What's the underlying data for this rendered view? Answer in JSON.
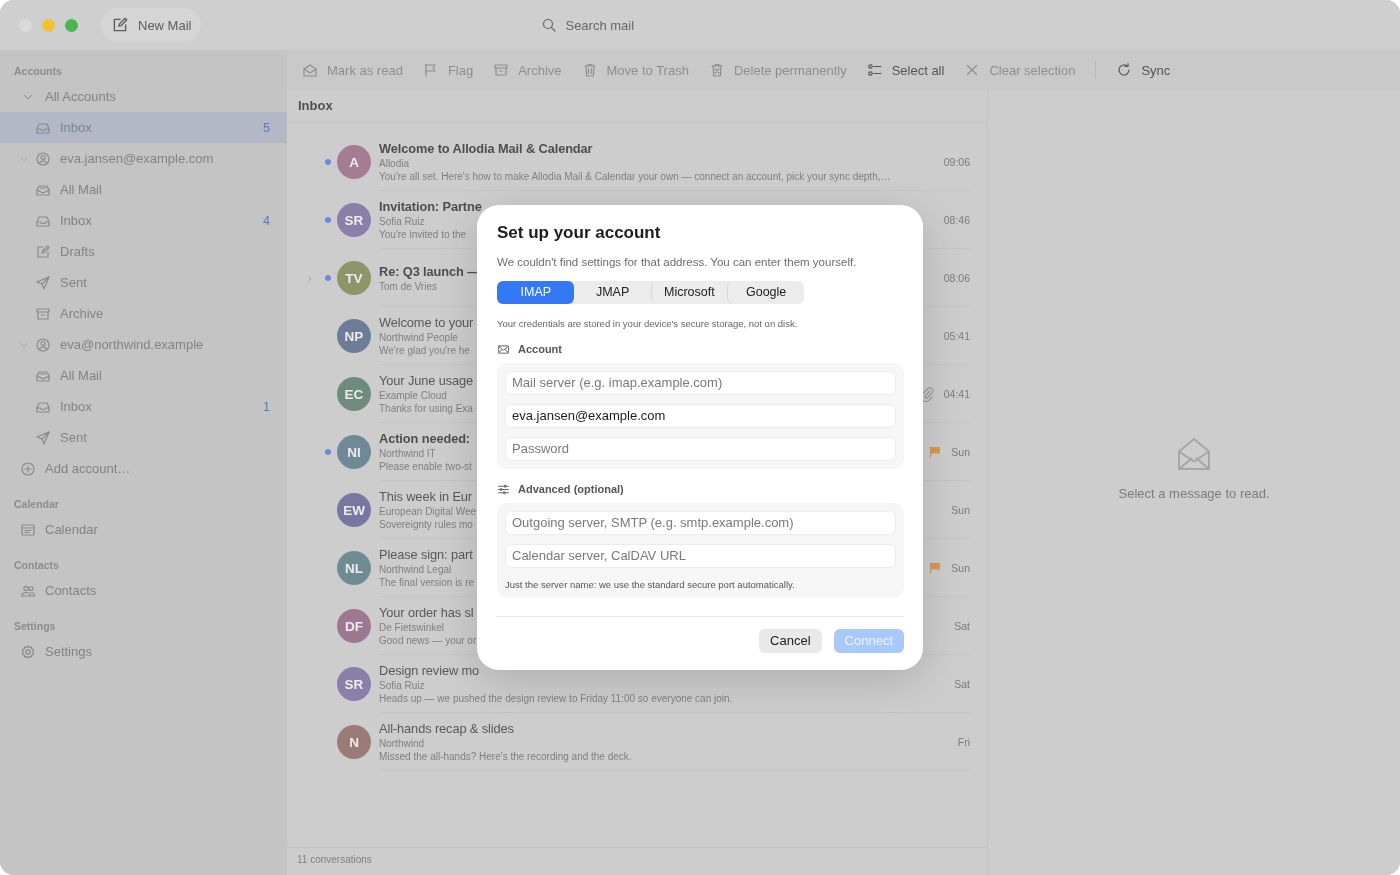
{
  "titlebar": {
    "new_mail": "New Mail",
    "search": {
      "placeholder": "Search mail"
    }
  },
  "sidebar": {
    "sections": [
      {
        "title": "Accounts",
        "items": [
          {
            "label": "All Accounts",
            "kind": "group",
            "selected": false,
            "expanded": true,
            "children": [
              {
                "label": "Inbox",
                "kind": "inbox",
                "selected": true,
                "count": "5"
              }
            ]
          },
          {
            "label": "eva.jansen@example.com",
            "kind": "account",
            "selected": false,
            "expanded": true,
            "children": [
              {
                "label": "All Mail",
                "kind": "all-mail",
                "selected": false
              },
              {
                "label": "Inbox",
                "kind": "inbox",
                "selected": false,
                "count": "4"
              },
              {
                "label": "Drafts",
                "kind": "drafts",
                "selected": false
              },
              {
                "label": "Sent",
                "kind": "sent",
                "selected": false
              },
              {
                "label": "Archive",
                "kind": "archive",
                "selected": false
              }
            ]
          },
          {
            "label": "eva@northwind.example",
            "kind": "account",
            "selected": false,
            "expanded": true,
            "children": [
              {
                "label": "All Mail",
                "kind": "all-mail",
                "selected": false
              },
              {
                "label": "Inbox",
                "kind": "inbox",
                "selected": false,
                "count": "1"
              },
              {
                "label": "Sent",
                "kind": "sent",
                "selected": false
              }
            ]
          },
          {
            "label": "Add account…",
            "kind": "add",
            "selected": false
          }
        ]
      },
      {
        "title": "Calendar",
        "items": [
          {
            "label": "Calendar",
            "kind": "calendar",
            "selected": false
          }
        ]
      },
      {
        "title": "Contacts",
        "items": [
          {
            "label": "Contacts",
            "kind": "contacts",
            "selected": false
          }
        ]
      },
      {
        "title": "Settings",
        "items": [
          {
            "label": "Settings",
            "kind": "settings",
            "selected": false
          }
        ]
      }
    ]
  },
  "toolbar": [
    {
      "label": "Mark as read",
      "kind": "mark-read",
      "disabled": true
    },
    {
      "label": "Flag",
      "kind": "flag",
      "disabled": true
    },
    {
      "label": "Archive",
      "kind": "archive",
      "disabled": true
    },
    {
      "label": "Move to Trash",
      "kind": "trash",
      "disabled": true
    },
    {
      "label": "Delete permanently",
      "kind": "delete",
      "disabled": true
    },
    {
      "label": "Select all",
      "kind": "select",
      "disabled": false
    },
    {
      "label": "Clear selection",
      "kind": "clear",
      "disabled": true
    },
    {
      "label": "Sync",
      "kind": "sync",
      "disabled": false
    }
  ],
  "list": {
    "title": "Inbox",
    "messages": [
      {
        "initials": "A",
        "color": "#a47c93",
        "unread": true,
        "thread": false,
        "subject": "Welcome to Allodia Mail & Calendar",
        "sender": "Allodia",
        "preview": "You're all set. Here's how to make Allodia Mail & Calendar your own — connect an account, pick your sync depth,…",
        "time": "09:06",
        "flagged": false,
        "attachment": false
      },
      {
        "initials": "SR",
        "color": "#8a7fa8",
        "unread": true,
        "thread": false,
        "subject": "Invitation: Partne",
        "sender": "Sofia Ruiz",
        "preview": "You're invited to the",
        "time": "08:46",
        "flagged": false,
        "attachment": false
      },
      {
        "initials": "TV",
        "color": "#8e9568",
        "unread": true,
        "thread": true,
        "subject": "Re: Q3 launch —",
        "sender": "Tom de Vries",
        "time": "08:06",
        "flagged": false,
        "attachment": false
      },
      {
        "initials": "NP",
        "color": "#6d7d98",
        "unread": false,
        "thread": false,
        "subject": "Welcome to your",
        "sender": "Northwind People",
        "preview": "We're glad you're he",
        "time": "05:41",
        "flagged": false,
        "attachment": false
      },
      {
        "initials": "EC",
        "color": "#6f8b80",
        "unread": false,
        "thread": false,
        "subject": "Your June usage",
        "sender": "Example Cloud",
        "preview": "Thanks for using Exa",
        "time": "04:41",
        "flagged": false,
        "attachment": true
      },
      {
        "initials": "NI",
        "color": "#6f8a96",
        "unread": true,
        "thread": false,
        "subject": "Action needed:",
        "sender": "Northwind IT",
        "preview": "Please enable two-st",
        "time": "Sun",
        "flagged": true,
        "attachment": false
      },
      {
        "initials": "EW",
        "color": "#7a76a2",
        "unread": false,
        "thread": false,
        "subject": "This week in Eur",
        "sender": "European Digital Wee",
        "preview": "Sovereignty rules mo",
        "time": "Sun",
        "flagged": false,
        "attachment": false
      },
      {
        "initials": "NL",
        "color": "#6f8c92",
        "unread": false,
        "thread": false,
        "subject": "Please sign: part",
        "sender": "Northwind Legal",
        "preview": "The final version is re",
        "time": "Sun",
        "flagged": true,
        "attachment": false
      },
      {
        "initials": "DF",
        "color": "#9c7892",
        "unread": false,
        "thread": false,
        "subject": "Your order has sl",
        "sender": "De Fietswinkel",
        "preview": "Good news — your or",
        "time": "Sat",
        "flagged": false,
        "attachment": false
      },
      {
        "initials": "SR",
        "color": "#8a7fa8",
        "unread": false,
        "thread": false,
        "subject": "Design review mo",
        "sender": "Sofia Ruiz",
        "preview": "Heads up — we pushed the design review to Friday 11:00 so everyone can join.",
        "time": "Sat",
        "flagged": false,
        "attachment": false
      },
      {
        "initials": "N",
        "color": "#9c7a78",
        "unread": false,
        "thread": false,
        "subject": "All-hands recap & slides",
        "sender": "Northwind",
        "preview": "Missed the all-hands? Here's the recording and the deck.",
        "time": "Fri",
        "flagged": false,
        "attachment": false
      }
    ],
    "footer": "11 conversations"
  },
  "reading_pane": {
    "empty_text": "Select a message to read."
  },
  "dialog": {
    "title": "Set up your account",
    "subtitle": "We couldn't find settings for that address. You can enter them yourself.",
    "tabs": [
      {
        "label": "IMAP",
        "selected": true
      },
      {
        "label": "JMAP",
        "selected": false
      },
      {
        "label": "Microsoft",
        "selected": false
      },
      {
        "label": "Google",
        "selected": false
      }
    ],
    "note": "Your credentials are stored in your device's secure storage, not on disk.",
    "groups": [
      {
        "title": "Account",
        "kind": "mail",
        "fields": [
          {
            "placeholder": "Mail server (e.g. imap.example.com)"
          },
          {
            "value": "eva.jansen@example.com"
          },
          {
            "placeholder": "Password"
          }
        ]
      },
      {
        "title": "Advanced (optional)",
        "kind": "sliders",
        "fields": [
          {
            "placeholder": "Outgoing server, SMTP (e.g. smtp.example.com)"
          },
          {
            "placeholder": "Calendar server, CalDAV URL"
          }
        ],
        "hint": "Just the server name: we use the standard secure port automatically."
      }
    ],
    "buttons": [
      {
        "label": "Cancel",
        "kind": "secondary",
        "disabled": false
      },
      {
        "label": "Connect",
        "kind": "primary",
        "disabled": true
      }
    ]
  }
}
